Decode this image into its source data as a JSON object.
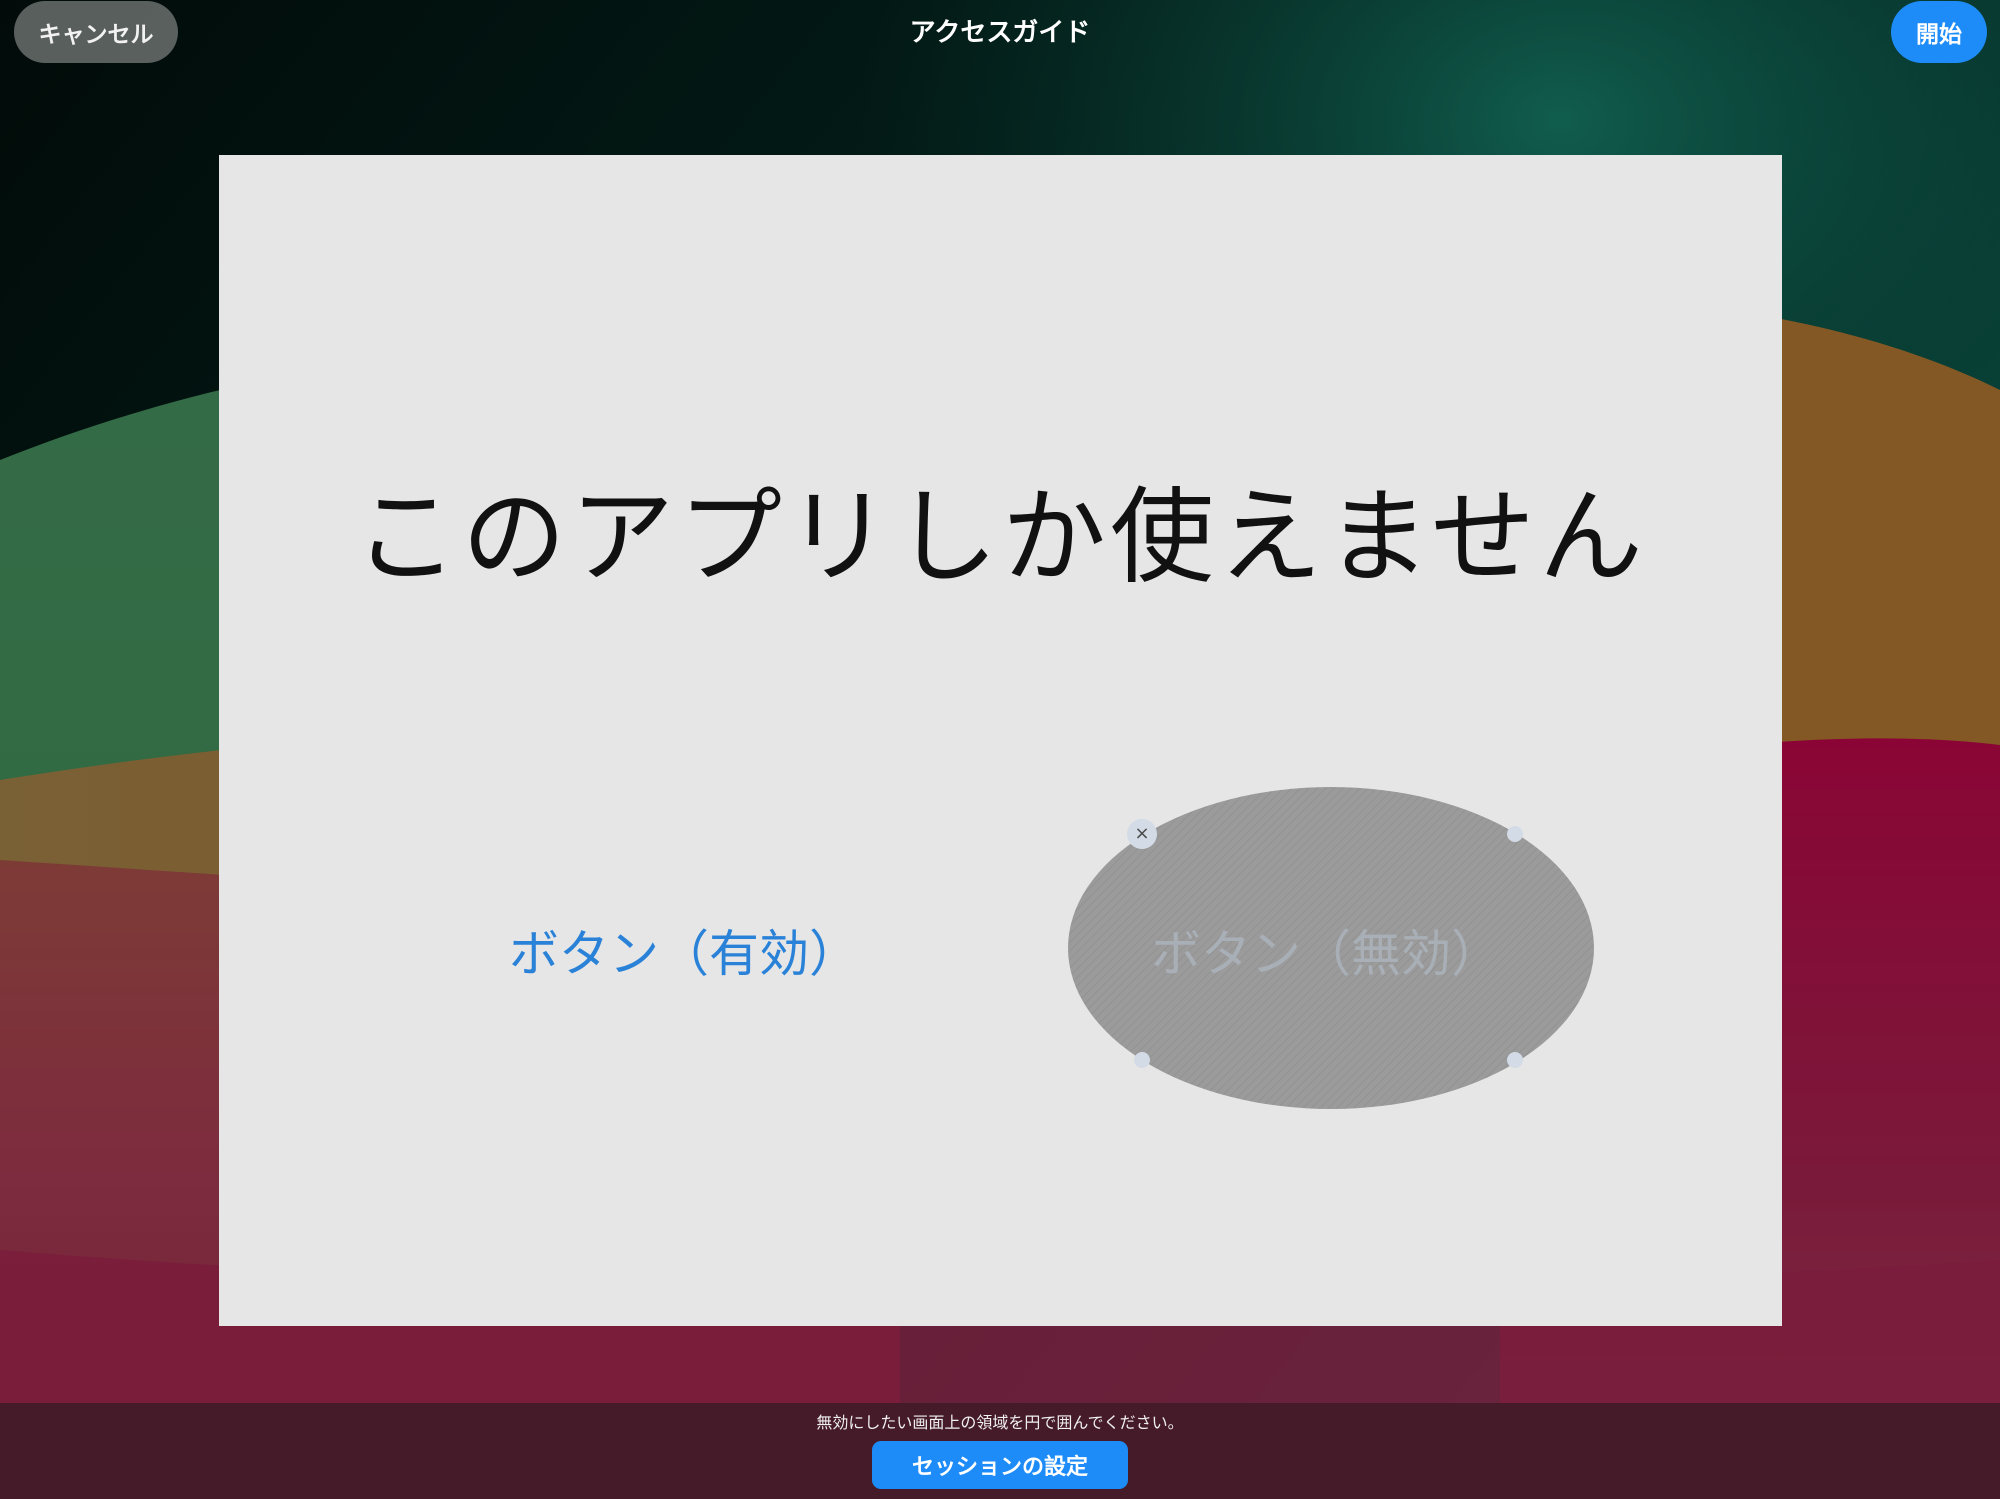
{
  "toolbar": {
    "cancel_label": "キャンセル",
    "title": "アクセスガイド",
    "start_label": "開始"
  },
  "app_preview": {
    "heading": "このアプリしか使えません",
    "enabled_button_label": "ボタン（有効）",
    "disabled_button_label": "ボタン（無効）",
    "disabled_area_remove_symbol": "×"
  },
  "bottom": {
    "hint": "無効にしたい画面上の領域を円で囲んでください。",
    "session_settings_label": "セッションの設定"
  },
  "colors": {
    "accent_blue": "#1d8cf8",
    "enabled_text": "#2a82d8",
    "disabled_area": "#9a9a9a",
    "preview_background": "#e6e6e6"
  }
}
